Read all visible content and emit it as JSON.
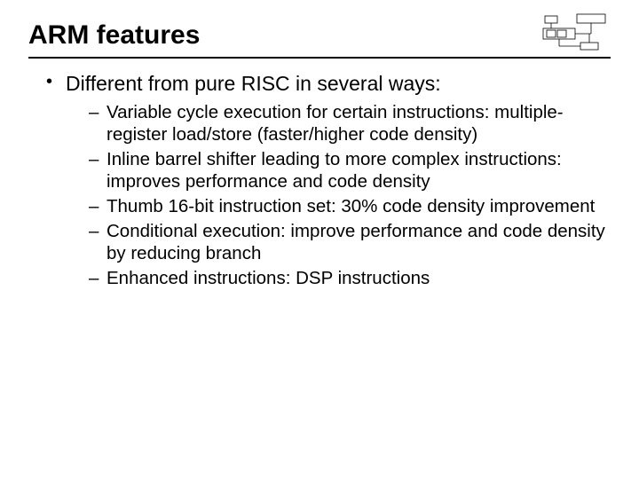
{
  "title": "ARM features",
  "bullet": {
    "text": "Different from pure RISC in several ways:",
    "sub": [
      "Variable cycle execution for certain instructions: multiple-register load/store (faster/higher code density)",
      "Inline barrel shifter leading to more complex instructions: improves performance and code density",
      "Thumb 16-bit instruction set: 30% code density improvement",
      "Conditional execution: improve performance and code density by reducing branch",
      "Enhanced instructions: DSP instructions"
    ]
  }
}
